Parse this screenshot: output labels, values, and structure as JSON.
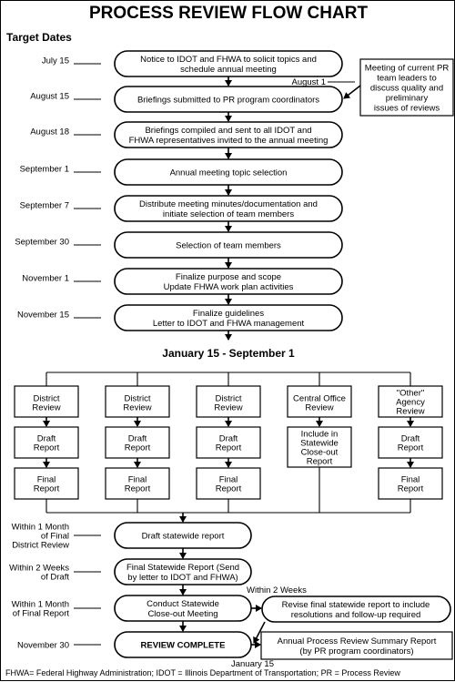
{
  "title": "PROCESS REVIEW FLOW CHART",
  "target_dates_heading": "Target Dates",
  "main_steps": [
    {
      "date": [
        "July 15"
      ],
      "text": [
        "Notice to IDOT and FHWA to solicit topics and",
        "schedule annual meeting"
      ]
    },
    {
      "date": [
        "August 15"
      ],
      "text": [
        "Briefings submitted to PR program coordinators"
      ]
    },
    {
      "date": [
        "August 18"
      ],
      "text": [
        "Briefings compiled and sent to all IDOT and",
        "FHWA representatives invited to the annual meeting"
      ]
    },
    {
      "date": [
        "September 1"
      ],
      "text": [
        "Annual meeting topic selection"
      ]
    },
    {
      "date": [
        "September 7"
      ],
      "text": [
        "Distribute meeting minutes/documentation and",
        "initiate selection of team members"
      ]
    },
    {
      "date": [
        "September 30"
      ],
      "text": [
        "Selection of team members"
      ]
    },
    {
      "date": [
        "November 1"
      ],
      "text": [
        "Finalize purpose and scope",
        "Update FHWA work plan activities"
      ]
    },
    {
      "date": [
        "November 15"
      ],
      "text": [
        "Finalize guidelines",
        "Letter to IDOT and FHWA management"
      ]
    }
  ],
  "side_note": {
    "date": "August 1",
    "text": [
      "Meeting of current PR",
      "team leaders to",
      "discuss quality and",
      "preliminary",
      "issues of reviews"
    ]
  },
  "review_period": "January 15 - September 1",
  "review_columns": [
    {
      "review": [
        "District",
        "Review"
      ],
      "draft": [
        "Draft",
        "Report"
      ],
      "final": [
        "Final",
        "Report"
      ]
    },
    {
      "review": [
        "District",
        "Review"
      ],
      "draft": [
        "Draft",
        "Report"
      ],
      "final": [
        "Final",
        "Report"
      ]
    },
    {
      "review": [
        "District",
        "Review"
      ],
      "draft": [
        "Draft",
        "Report"
      ],
      "final": [
        "Final",
        "Report"
      ]
    },
    {
      "review": [
        "Central Office",
        "Review"
      ],
      "draft": [
        "Include in",
        "Statewide",
        "Close-out",
        "Report"
      ],
      "final": null
    },
    {
      "review": [
        "\"Other\"",
        "Agency",
        "Review"
      ],
      "draft": [
        "Draft",
        "Report"
      ],
      "final": [
        "Final",
        "Report"
      ]
    }
  ],
  "final_steps": [
    {
      "date": [
        "Within 1 Month",
        "of Final",
        "District Review"
      ],
      "text": [
        "Draft statewide report"
      ]
    },
    {
      "date": [
        "Within 2 Weeks",
        "of Draft"
      ],
      "text": [
        "Final Statewide Report (Send",
        "by letter to IDOT and FHWA)"
      ]
    },
    {
      "date": [
        "Within 1 Month",
        "of Final Report"
      ],
      "text": [
        "Conduct Statewide",
        "Close-out Meeting"
      ]
    },
    {
      "date": [
        "November 30"
      ],
      "text": [
        "REVIEW COMPLETE"
      ]
    }
  ],
  "revise_label": "Within 2 Weeks",
  "revise_box": [
    "Revise final statewide report to include",
    "resolutions and follow-up required"
  ],
  "summary_box": [
    "Annual Process Review Summary Report",
    "(by PR program coordinators)"
  ],
  "summary_date": "January 15",
  "footnote": "FHWA= Federal Highway Administration; IDOT = Illinois Department of Transportation; PR = Process Review"
}
